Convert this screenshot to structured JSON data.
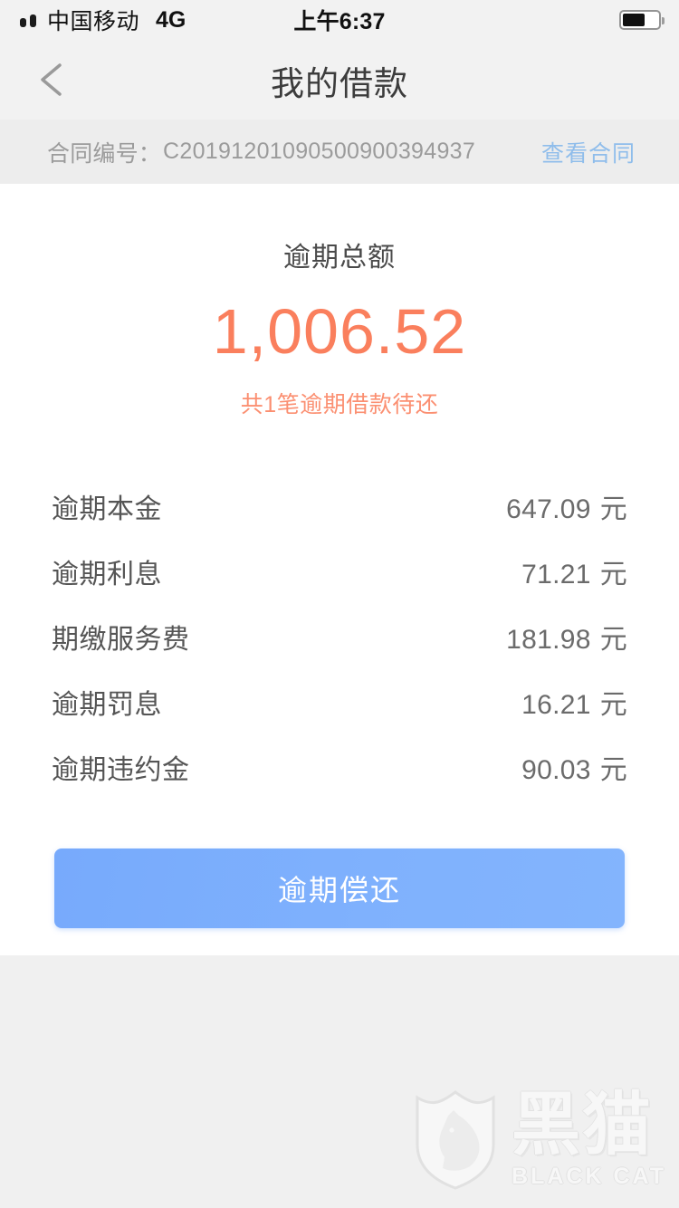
{
  "status_bar": {
    "carrier": "中国移动",
    "network": "4G",
    "time": "上午6:37",
    "battery_level_percent": 56
  },
  "nav": {
    "title": "我的借款",
    "back_icon": "chevron-left-icon"
  },
  "contract": {
    "label": "合同编号：",
    "number": "C20191201090500900394937",
    "link_label": "查看合同"
  },
  "summary": {
    "title": "逾期总额",
    "amount": "1,006.52",
    "note": "共1笔逾期借款待还",
    "accent_color": "#fa7f5d"
  },
  "details": {
    "unit": "元",
    "rows": [
      {
        "label": "逾期本金",
        "value": "647.09"
      },
      {
        "label": "逾期利息",
        "value": "71.21"
      },
      {
        "label": "期缴服务费",
        "value": "181.98"
      },
      {
        "label": "逾期罚息",
        "value": "16.21"
      },
      {
        "label": "逾期违约金",
        "value": "90.03"
      }
    ]
  },
  "action": {
    "pay_label": "逾期偿还",
    "button_color": "#7fb1fd"
  },
  "watermark": {
    "icon": "black-cat-shield-icon",
    "cn": "黑猫",
    "en": "BLACK CAT"
  }
}
